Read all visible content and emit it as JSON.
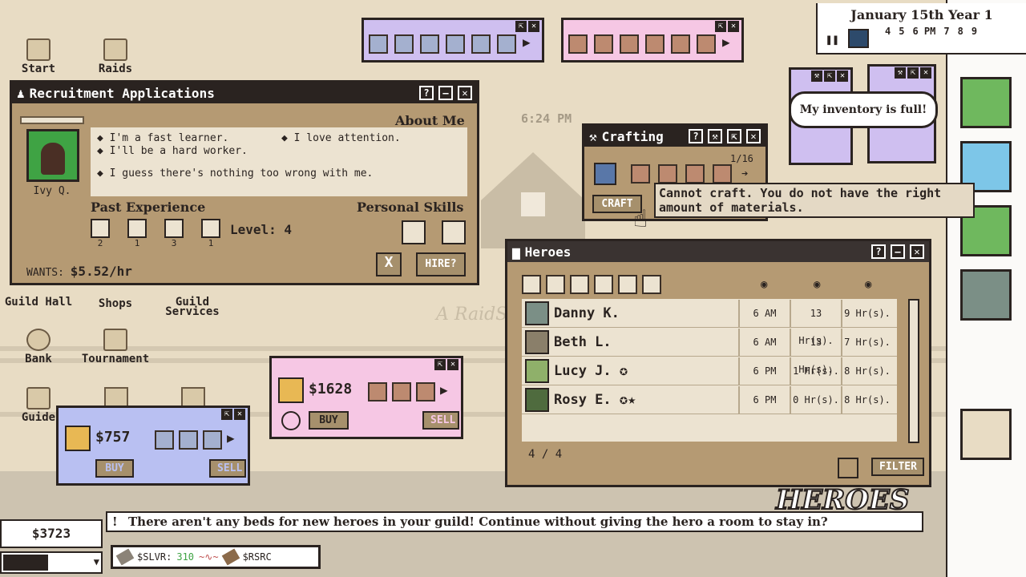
{
  "clock": {
    "date": "January 15th Year 1",
    "hours": [
      "4",
      "5",
      "6 PM",
      "7",
      "8",
      "9"
    ],
    "time_watermark": "6:24 PM"
  },
  "background": {
    "logo_sub": "A RaidS"
  },
  "desktop": {
    "icons": [
      {
        "label": "Start"
      },
      {
        "label": "Raids"
      },
      {
        "label": "Guild Hall"
      },
      {
        "label": "Shops"
      },
      {
        "label": "Guild Services"
      },
      {
        "label": "Bank"
      },
      {
        "label": "Tournament"
      },
      {
        "label": "Guide"
      }
    ]
  },
  "recruit": {
    "title": "Recruitment Applications",
    "about_title": "About Me",
    "name": "Ivy Q.",
    "about": [
      "I'm a fast learner.",
      "I love attention.",
      "I'll be a hard worker.",
      "I guess there's nothing too wrong with me."
    ],
    "past_exp_title": "Past Experience",
    "skills_title": "Personal Skills",
    "exp_counts": [
      "2",
      "1",
      "3",
      "1"
    ],
    "level": "Level: 4",
    "wants": "WANTS:",
    "wage": "$5.52/hr",
    "hire": "HIRE?",
    "reject": "X"
  },
  "crafting": {
    "title": "Crafting",
    "page": "1/16",
    "craft": "CRAFT",
    "tooltip": "Cannot craft. You do not have the right amount of materials."
  },
  "speech": {
    "text": "My inventory is full!"
  },
  "heroes": {
    "title": "Heroes",
    "count": "4 / 4",
    "filter": "FILTER",
    "list": [
      {
        "name": "Danny K.",
        "c1": "6 AM",
        "c2": "13 Hr(s).",
        "c3": "9 Hr(s).",
        "color": "#7b8f86"
      },
      {
        "name": "Beth L.",
        "c1": "6 AM",
        "c2": "13 Hr(s).",
        "c3": "7 Hr(s).",
        "color": "#8a7f6a"
      },
      {
        "name": "Lucy J.",
        "c1": "6 PM",
        "c2": "1 Hr(s).",
        "c3": "8 Hr(s).",
        "color": "#8fb06a"
      },
      {
        "name": "Rosy E.",
        "c1": "6 PM",
        "c2": "0 Hr(s).",
        "c3": "8 Hr(s).",
        "color": "#4f6b3e"
      }
    ]
  },
  "shop_pink": {
    "price": "$1628",
    "buy": "BUY",
    "sell": "SELL"
  },
  "shop_blue": {
    "price": "$757",
    "buy": "BUY",
    "sell": "SELL"
  },
  "notice": {
    "bang": "!",
    "text": "There aren't any beds for new heroes in your guild! Continue without giving the hero a room to stay in?",
    "heroes_logo": "HEROES"
  },
  "money": {
    "gold": "$3723"
  },
  "ticker": {
    "slvr": "$SLVR:",
    "slvr_val": "310",
    "rsrc": "$RSRC"
  },
  "colors": {
    "frame": "#2a2320",
    "panel": "#b59a73",
    "pink": "#f6c7e4",
    "blue": "#b9c0f2",
    "lilac": "#cfbff0"
  }
}
